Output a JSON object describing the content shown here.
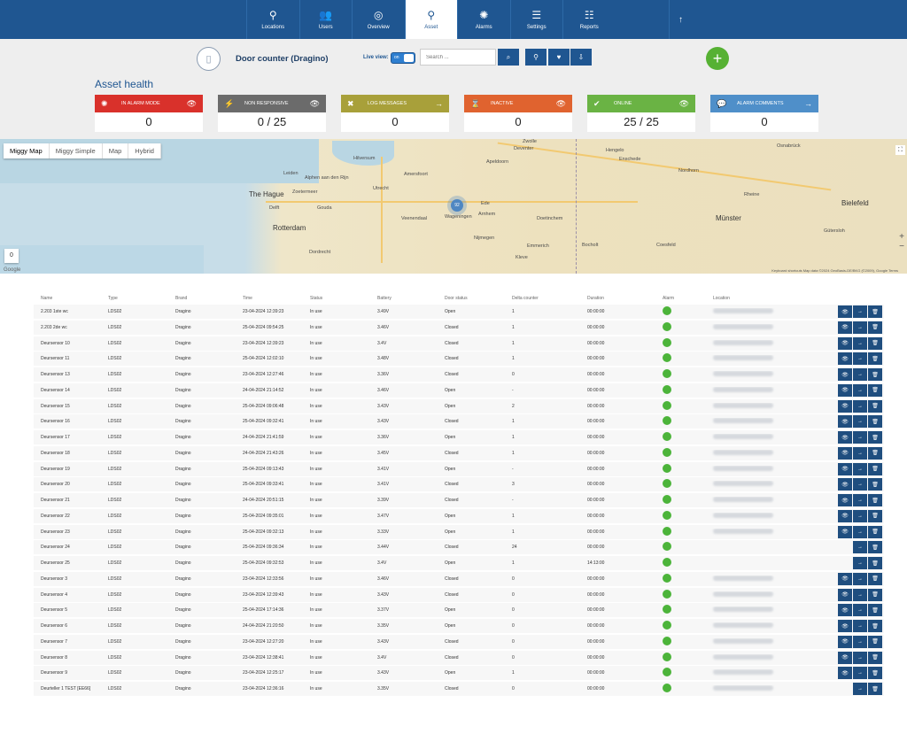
{
  "nav": {
    "items": [
      {
        "label": "Locations",
        "icon": "pin-icon",
        "glyph": "⚲",
        "active": false
      },
      {
        "label": "Users",
        "icon": "users-icon",
        "glyph": "👥",
        "active": false
      },
      {
        "label": "Overview",
        "icon": "bike-icon",
        "glyph": "◎",
        "active": false
      },
      {
        "label": "Asset",
        "icon": "asset-pin-icon",
        "glyph": "⚲",
        "active": true
      },
      {
        "label": "Alarms",
        "icon": "alarm-icon",
        "glyph": "✺",
        "active": false
      },
      {
        "label": "Settings",
        "icon": "sliders-icon",
        "glyph": "☰",
        "active": false
      },
      {
        "label": "Reports",
        "icon": "list-icon",
        "glyph": "☷",
        "active": false
      }
    ],
    "up_glyph": "↑"
  },
  "header": {
    "device_icon": "door-icon",
    "device_title": "Door counter (Dragino)",
    "live_view_label": "Live view:",
    "toggle_on": "on",
    "search_placeholder": "Search ...",
    "add_glyph": "+"
  },
  "health": {
    "title": "Asset health",
    "cards": [
      {
        "label": "IN ALARM MODE",
        "value": "0",
        "color": "#d9312b",
        "icon": "alarm-icon",
        "glyph": "✺",
        "action": "👁"
      },
      {
        "label": "NON RESPONSIVE",
        "value": "0 / 25",
        "color": "#6b6b6b",
        "icon": "unplug-icon",
        "glyph": "⚡",
        "action": "👁"
      },
      {
        "label": "LOG MESSAGES",
        "value": "0",
        "color": "#a8a03a",
        "icon": "cross-icon",
        "glyph": "✖",
        "action": "→"
      },
      {
        "label": "INACTIVE",
        "value": "0",
        "color": "#e0632f",
        "icon": "hourglass-icon",
        "glyph": "⌛",
        "action": "👁"
      },
      {
        "label": "ONLINE",
        "value": "25 / 25",
        "color": "#6ab344",
        "icon": "check-icon",
        "glyph": "✔",
        "action": "👁"
      },
      {
        "label": "ALARM COMMENTS",
        "value": "0",
        "color": "#4f8fc9",
        "icon": "comment-icon",
        "glyph": "💬",
        "action": "→"
      }
    ]
  },
  "map": {
    "tabs": [
      "Miggy Map",
      "Miggy Simple",
      "Map",
      "Hybrid"
    ],
    "cluster": "92",
    "zero": "0",
    "credit": "Keyboard shortcuts   Map data ©2024 GeoBasis-DE/BKG (©2009), Google   Terms",
    "google": "Google",
    "cities": [
      {
        "name": "The Hague",
        "big": true
      },
      {
        "name": "Rotterdam",
        "big": true
      },
      {
        "name": "Bielefeld",
        "big": true
      },
      {
        "name": "Münster",
        "big": true
      },
      {
        "name": "Leiden"
      },
      {
        "name": "Utrecht"
      },
      {
        "name": "Amersfoort"
      },
      {
        "name": "Apeldoorn"
      },
      {
        "name": "Deventer"
      },
      {
        "name": "Arnhem"
      },
      {
        "name": "Nijmegen"
      },
      {
        "name": "Enschede"
      },
      {
        "name": "Hengelo"
      },
      {
        "name": "Zwolle"
      },
      {
        "name": "Hilversum"
      },
      {
        "name": "Gouda"
      },
      {
        "name": "Dordrecht"
      },
      {
        "name": "Wageningen"
      },
      {
        "name": "Doetinchem"
      },
      {
        "name": "Bocholt"
      },
      {
        "name": "Coesfeld"
      },
      {
        "name": "Gütersloh"
      },
      {
        "name": "Osnabrück"
      },
      {
        "name": "Nordhorn"
      },
      {
        "name": "Rheine"
      },
      {
        "name": "Emmerich"
      },
      {
        "name": "Kleve"
      },
      {
        "name": "Delft"
      },
      {
        "name": "Zoetermeer"
      },
      {
        "name": "Alphen aan den Rijn"
      },
      {
        "name": "Veenendaal"
      },
      {
        "name": "Ede"
      }
    ]
  },
  "table": {
    "headers": [
      "Name",
      "Type",
      "Brand",
      "Time",
      "Status",
      "Battery",
      "Door status",
      "Delta counter",
      "Duration",
      "Alarm",
      "Location"
    ],
    "rows": [
      {
        "name": "2.203 1ste wc",
        "type": "LDS02",
        "brand": "Dragino",
        "time": "23-04-2024 12:39:23",
        "status": "In use",
        "battery": "3.49V",
        "door": "Open",
        "delta": "1",
        "duration": "00:00:00",
        "alarm": true,
        "loc": true,
        "eye": true
      },
      {
        "name": "2.203 2de wc",
        "type": "LDS02",
        "brand": "Dragino",
        "time": "25-04-2024 09:54:25",
        "status": "In use",
        "battery": "3.46V",
        "door": "Closed",
        "delta": "1",
        "duration": "00:00:00",
        "alarm": true,
        "loc": true,
        "eye": true
      },
      {
        "name": "Deursensor 10",
        "type": "LDS02",
        "brand": "Dragino",
        "time": "23-04-2024 12:39:23",
        "status": "In use",
        "battery": "3.4V",
        "door": "Closed",
        "delta": "1",
        "duration": "00:00:00",
        "alarm": true,
        "loc": true,
        "eye": true
      },
      {
        "name": "Deursensor 11",
        "type": "LDS02",
        "brand": "Dragino",
        "time": "25-04-2024 12:02:10",
        "status": "In use",
        "battery": "3.48V",
        "door": "Closed",
        "delta": "1",
        "duration": "00:00:00",
        "alarm": true,
        "loc": true,
        "eye": true
      },
      {
        "name": "Deursensor 13",
        "type": "LDS02",
        "brand": "Dragino",
        "time": "23-04-2024 12:27:46",
        "status": "In use",
        "battery": "3.36V",
        "door": "Closed",
        "delta": "0",
        "duration": "00:00:00",
        "alarm": true,
        "loc": true,
        "eye": true
      },
      {
        "name": "Deursensor 14",
        "type": "LDS02",
        "brand": "Dragino",
        "time": "24-04-2024 21:14:52",
        "status": "In use",
        "battery": "3.46V",
        "door": "Open",
        "delta": "-",
        "duration": "00:00:00",
        "alarm": true,
        "loc": true,
        "eye": true
      },
      {
        "name": "Deursensor 15",
        "type": "LDS02",
        "brand": "Dragino",
        "time": "25-04-2024 09:06:48",
        "status": "In use",
        "battery": "3.43V",
        "door": "Open",
        "delta": "2",
        "duration": "00:00:00",
        "alarm": true,
        "loc": true,
        "eye": true
      },
      {
        "name": "Deursensor 16",
        "type": "LDS02",
        "brand": "Dragino",
        "time": "25-04-2024 09:32:41",
        "status": "In use",
        "battery": "3.43V",
        "door": "Closed",
        "delta": "1",
        "duration": "00:00:00",
        "alarm": true,
        "loc": true,
        "eye": true
      },
      {
        "name": "Deursensor 17",
        "type": "LDS02",
        "brand": "Dragino",
        "time": "24-04-2024 21:41:59",
        "status": "In use",
        "battery": "3.36V",
        "door": "Open",
        "delta": "1",
        "duration": "00:00:00",
        "alarm": true,
        "loc": true,
        "eye": true
      },
      {
        "name": "Deursensor 18",
        "type": "LDS02",
        "brand": "Dragino",
        "time": "24-04-2024 21:43:26",
        "status": "In use",
        "battery": "3.45V",
        "door": "Closed",
        "delta": "1",
        "duration": "00:00:00",
        "alarm": true,
        "loc": true,
        "eye": true
      },
      {
        "name": "Deursensor 19",
        "type": "LDS02",
        "brand": "Dragino",
        "time": "25-04-2024 09:13:43",
        "status": "In use",
        "battery": "3.41V",
        "door": "Open",
        "delta": "-",
        "duration": "00:00:00",
        "alarm": true,
        "loc": true,
        "eye": true
      },
      {
        "name": "Deursensor 20",
        "type": "LDS02",
        "brand": "Dragino",
        "time": "25-04-2024 09:33:41",
        "status": "In use",
        "battery": "3.41V",
        "door": "Closed",
        "delta": "3",
        "duration": "00:00:00",
        "alarm": true,
        "loc": true,
        "eye": true
      },
      {
        "name": "Deursensor 21",
        "type": "LDS02",
        "brand": "Dragino",
        "time": "24-04-2024 20:51:15",
        "status": "In use",
        "battery": "3.39V",
        "door": "Closed",
        "delta": "-",
        "duration": "00:00:00",
        "alarm": true,
        "loc": true,
        "eye": true
      },
      {
        "name": "Deursensor 22",
        "type": "LDS02",
        "brand": "Dragino",
        "time": "25-04-2024 09:35:01",
        "status": "In use",
        "battery": "3.47V",
        "door": "Open",
        "delta": "1",
        "duration": "00:00:00",
        "alarm": true,
        "loc": true,
        "eye": true
      },
      {
        "name": "Deursensor 23",
        "type": "LDS02",
        "brand": "Dragino",
        "time": "25-04-2024 09:32:13",
        "status": "In use",
        "battery": "3.33V",
        "door": "Open",
        "delta": "1",
        "duration": "00:00:00",
        "alarm": true,
        "loc": true,
        "eye": true
      },
      {
        "name": "Deursensor 24",
        "type": "LDS02",
        "brand": "Dragino",
        "time": "25-04-2024 09:36:34",
        "status": "In use",
        "battery": "3.44V",
        "door": "Closed",
        "delta": "24",
        "duration": "00:00:00",
        "alarm": true,
        "loc": false,
        "eye": false
      },
      {
        "name": "Deursensor 25",
        "type": "LDS02",
        "brand": "Dragino",
        "time": "25-04-2024 09:32:53",
        "status": "In use",
        "battery": "3.4V",
        "door": "Open",
        "delta": "1",
        "duration": "14:13:00",
        "alarm": true,
        "loc": false,
        "eye": false
      },
      {
        "name": "Deursensor 3",
        "type": "LDS02",
        "brand": "Dragino",
        "time": "23-04-2024 12:33:56",
        "status": "In use",
        "battery": "3.46V",
        "door": "Closed",
        "delta": "0",
        "duration": "00:00:00",
        "alarm": true,
        "loc": true,
        "eye": true
      },
      {
        "name": "Deursensor 4",
        "type": "LDS02",
        "brand": "Dragino",
        "time": "23-04-2024 12:39:43",
        "status": "In use",
        "battery": "3.43V",
        "door": "Closed",
        "delta": "0",
        "duration": "00:00:00",
        "alarm": true,
        "loc": true,
        "eye": true
      },
      {
        "name": "Deursensor 5",
        "type": "LDS02",
        "brand": "Dragino",
        "time": "25-04-2024 17:14:36",
        "status": "In use",
        "battery": "3.37V",
        "door": "Open",
        "delta": "0",
        "duration": "00:00:00",
        "alarm": true,
        "loc": true,
        "eye": true
      },
      {
        "name": "Deursensor 6",
        "type": "LDS02",
        "brand": "Dragino",
        "time": "24-04-2024 21:20:50",
        "status": "In use",
        "battery": "3.35V",
        "door": "Open",
        "delta": "0",
        "duration": "00:00:00",
        "alarm": true,
        "loc": true,
        "eye": true
      },
      {
        "name": "Deursensor 7",
        "type": "LDS02",
        "brand": "Dragino",
        "time": "23-04-2024 12:27:20",
        "status": "In use",
        "battery": "3.43V",
        "door": "Closed",
        "delta": "0",
        "duration": "00:00:00",
        "alarm": true,
        "loc": true,
        "eye": true
      },
      {
        "name": "Deursensor 8",
        "type": "LDS02",
        "brand": "Dragino",
        "time": "23-04-2024 12:38:41",
        "status": "In use",
        "battery": "3.4V",
        "door": "Closed",
        "delta": "0",
        "duration": "00:00:00",
        "alarm": true,
        "loc": true,
        "eye": true
      },
      {
        "name": "Deursensor 9",
        "type": "LDS02",
        "brand": "Dragino",
        "time": "23-04-2024 12:25:17",
        "status": "In use",
        "battery": "3.43V",
        "door": "Open",
        "delta": "1",
        "duration": "00:00:00",
        "alarm": true,
        "loc": true,
        "eye": true
      },
      {
        "name": "Deurteller 1 TEST [EE66]",
        "type": "LDS02",
        "brand": "Dragino",
        "time": "23-04-2024 12:36:16",
        "status": "In use",
        "battery": "3.35V",
        "door": "Closed",
        "delta": "0",
        "duration": "00:00:00",
        "alarm": true,
        "loc": true,
        "eye": false
      }
    ],
    "action_glyphs": {
      "eye": "👁",
      "go": "→",
      "delete": "🗑"
    }
  }
}
